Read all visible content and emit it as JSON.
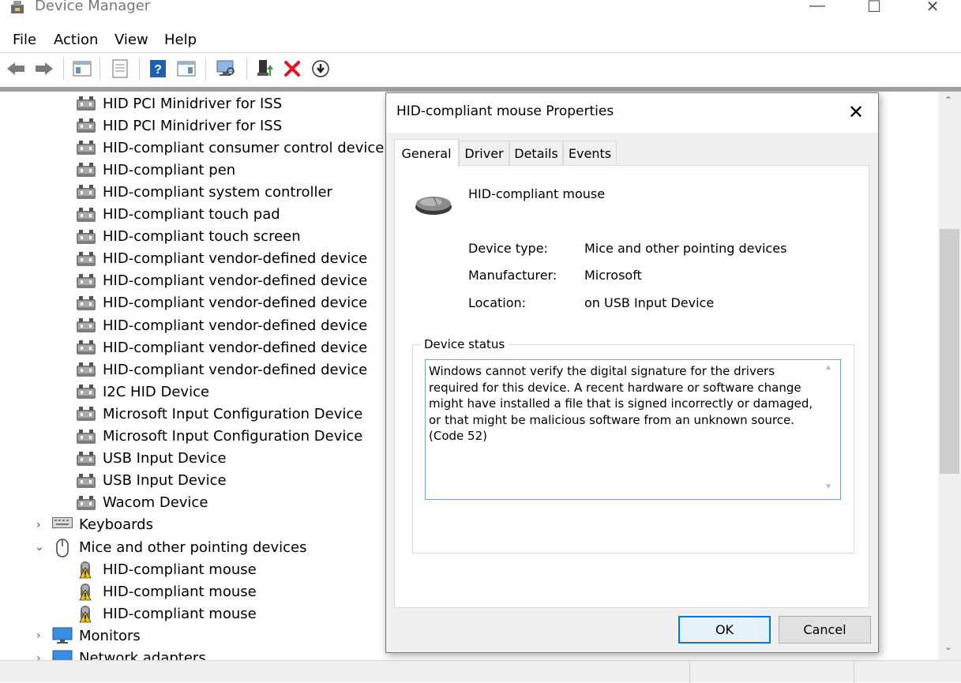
{
  "window": {
    "title": "Device Manager",
    "controls": {
      "minimize": "—",
      "maximize": "☐",
      "close": "✕"
    }
  },
  "menu": [
    "File",
    "Action",
    "View",
    "Help"
  ],
  "toolbar": {
    "icons": [
      "back-arrow-icon",
      "forward-arrow-icon",
      "show-hide-console-tree-icon",
      "properties-icon",
      "help-icon",
      "action-pane-icon",
      "scan-hardware-icon",
      "update-driver-icon",
      "uninstall-device-icon",
      "enable-download-icon"
    ]
  },
  "tree": {
    "hid_items": [
      "HID PCI Minidriver for ISS",
      "HID PCI Minidriver for ISS",
      "HID-compliant consumer control device",
      "HID-compliant pen",
      "HID-compliant system controller",
      "HID-compliant touch pad",
      "HID-compliant touch screen",
      "HID-compliant vendor-defined device",
      "HID-compliant vendor-defined device",
      "HID-compliant vendor-defined device",
      "HID-compliant vendor-defined device",
      "HID-compliant vendor-defined device",
      "HID-compliant vendor-defined device",
      "I2C HID Device",
      "Microsoft Input Configuration Device",
      "Microsoft Input Configuration Device",
      "USB Input Device",
      "USB Input Device",
      "Wacom Device"
    ],
    "keyboards": "Keyboards",
    "mice_category": "Mice and other pointing devices",
    "mice_items": [
      "HID-compliant mouse",
      "HID-compliant mouse",
      "HID-compliant mouse"
    ],
    "monitors": "Monitors",
    "network": "Network adapters"
  },
  "dialog": {
    "title": "HID-compliant mouse Properties",
    "close": "✕",
    "tabs": [
      "General",
      "Driver",
      "Details",
      "Events"
    ],
    "active_tab": "General",
    "device_name": "HID-compliant mouse",
    "properties": {
      "device_type_label": "Device type:",
      "device_type_value": "Mice and other pointing devices",
      "manufacturer_label": "Manufacturer:",
      "manufacturer_value": "Microsoft",
      "location_label": "Location:",
      "location_value": "on USB Input Device"
    },
    "status_group_label": "Device status",
    "status_text": "Windows cannot verify the digital signature for the drivers required for this device. A recent hardware or software change might have installed a file that is signed incorrectly or damaged, or that might be malicious software from an unknown source. (Code 52)",
    "ok_label": "OK",
    "cancel_label": "Cancel"
  },
  "colors": {
    "accent": "#0078d7",
    "warning": "#f2c500",
    "error_x": "#e81123"
  }
}
